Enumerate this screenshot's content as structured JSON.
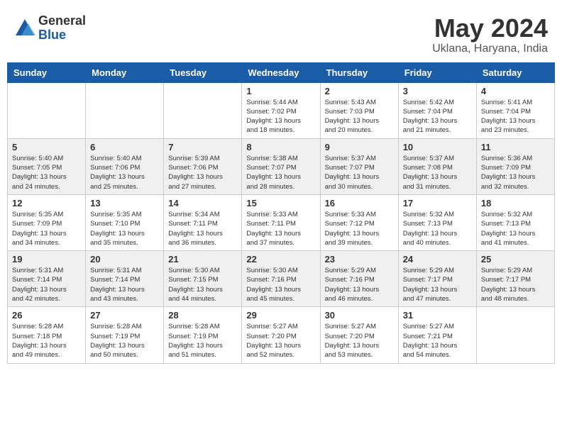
{
  "header": {
    "logo_general": "General",
    "logo_blue": "Blue",
    "month_year": "May 2024",
    "location": "Uklana, Haryana, India"
  },
  "weekdays": [
    "Sunday",
    "Monday",
    "Tuesday",
    "Wednesday",
    "Thursday",
    "Friday",
    "Saturday"
  ],
  "weeks": [
    [
      {
        "day": "",
        "info": ""
      },
      {
        "day": "",
        "info": ""
      },
      {
        "day": "",
        "info": ""
      },
      {
        "day": "1",
        "info": "Sunrise: 5:44 AM\nSunset: 7:02 PM\nDaylight: 13 hours\nand 18 minutes."
      },
      {
        "day": "2",
        "info": "Sunrise: 5:43 AM\nSunset: 7:03 PM\nDaylight: 13 hours\nand 20 minutes."
      },
      {
        "day": "3",
        "info": "Sunrise: 5:42 AM\nSunset: 7:04 PM\nDaylight: 13 hours\nand 21 minutes."
      },
      {
        "day": "4",
        "info": "Sunrise: 5:41 AM\nSunset: 7:04 PM\nDaylight: 13 hours\nand 23 minutes."
      }
    ],
    [
      {
        "day": "5",
        "info": "Sunrise: 5:40 AM\nSunset: 7:05 PM\nDaylight: 13 hours\nand 24 minutes."
      },
      {
        "day": "6",
        "info": "Sunrise: 5:40 AM\nSunset: 7:06 PM\nDaylight: 13 hours\nand 25 minutes."
      },
      {
        "day": "7",
        "info": "Sunrise: 5:39 AM\nSunset: 7:06 PM\nDaylight: 13 hours\nand 27 minutes."
      },
      {
        "day": "8",
        "info": "Sunrise: 5:38 AM\nSunset: 7:07 PM\nDaylight: 13 hours\nand 28 minutes."
      },
      {
        "day": "9",
        "info": "Sunrise: 5:37 AM\nSunset: 7:07 PM\nDaylight: 13 hours\nand 30 minutes."
      },
      {
        "day": "10",
        "info": "Sunrise: 5:37 AM\nSunset: 7:08 PM\nDaylight: 13 hours\nand 31 minutes."
      },
      {
        "day": "11",
        "info": "Sunrise: 5:36 AM\nSunset: 7:09 PM\nDaylight: 13 hours\nand 32 minutes."
      }
    ],
    [
      {
        "day": "12",
        "info": "Sunrise: 5:35 AM\nSunset: 7:09 PM\nDaylight: 13 hours\nand 34 minutes."
      },
      {
        "day": "13",
        "info": "Sunrise: 5:35 AM\nSunset: 7:10 PM\nDaylight: 13 hours\nand 35 minutes."
      },
      {
        "day": "14",
        "info": "Sunrise: 5:34 AM\nSunset: 7:11 PM\nDaylight: 13 hours\nand 36 minutes."
      },
      {
        "day": "15",
        "info": "Sunrise: 5:33 AM\nSunset: 7:11 PM\nDaylight: 13 hours\nand 37 minutes."
      },
      {
        "day": "16",
        "info": "Sunrise: 5:33 AM\nSunset: 7:12 PM\nDaylight: 13 hours\nand 39 minutes."
      },
      {
        "day": "17",
        "info": "Sunrise: 5:32 AM\nSunset: 7:13 PM\nDaylight: 13 hours\nand 40 minutes."
      },
      {
        "day": "18",
        "info": "Sunrise: 5:32 AM\nSunset: 7:13 PM\nDaylight: 13 hours\nand 41 minutes."
      }
    ],
    [
      {
        "day": "19",
        "info": "Sunrise: 5:31 AM\nSunset: 7:14 PM\nDaylight: 13 hours\nand 42 minutes."
      },
      {
        "day": "20",
        "info": "Sunrise: 5:31 AM\nSunset: 7:14 PM\nDaylight: 13 hours\nand 43 minutes."
      },
      {
        "day": "21",
        "info": "Sunrise: 5:30 AM\nSunset: 7:15 PM\nDaylight: 13 hours\nand 44 minutes."
      },
      {
        "day": "22",
        "info": "Sunrise: 5:30 AM\nSunset: 7:16 PM\nDaylight: 13 hours\nand 45 minutes."
      },
      {
        "day": "23",
        "info": "Sunrise: 5:29 AM\nSunset: 7:16 PM\nDaylight: 13 hours\nand 46 minutes."
      },
      {
        "day": "24",
        "info": "Sunrise: 5:29 AM\nSunset: 7:17 PM\nDaylight: 13 hours\nand 47 minutes."
      },
      {
        "day": "25",
        "info": "Sunrise: 5:29 AM\nSunset: 7:17 PM\nDaylight: 13 hours\nand 48 minutes."
      }
    ],
    [
      {
        "day": "26",
        "info": "Sunrise: 5:28 AM\nSunset: 7:18 PM\nDaylight: 13 hours\nand 49 minutes."
      },
      {
        "day": "27",
        "info": "Sunrise: 5:28 AM\nSunset: 7:19 PM\nDaylight: 13 hours\nand 50 minutes."
      },
      {
        "day": "28",
        "info": "Sunrise: 5:28 AM\nSunset: 7:19 PM\nDaylight: 13 hours\nand 51 minutes."
      },
      {
        "day": "29",
        "info": "Sunrise: 5:27 AM\nSunset: 7:20 PM\nDaylight: 13 hours\nand 52 minutes."
      },
      {
        "day": "30",
        "info": "Sunrise: 5:27 AM\nSunset: 7:20 PM\nDaylight: 13 hours\nand 53 minutes."
      },
      {
        "day": "31",
        "info": "Sunrise: 5:27 AM\nSunset: 7:21 PM\nDaylight: 13 hours\nand 54 minutes."
      },
      {
        "day": "",
        "info": ""
      }
    ]
  ]
}
